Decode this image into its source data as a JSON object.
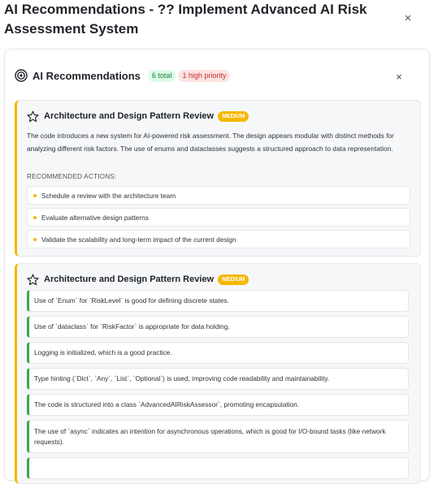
{
  "dialog": {
    "title": "AI Recommendations - ?? Implement Advanced AI Risk Assessment System",
    "close_glyph": "×"
  },
  "panel": {
    "title": "AI Recommendations",
    "total_badge": "6 total",
    "high_badge": "1 high priority",
    "close_glyph": "×"
  },
  "cards": [
    {
      "title": "Architecture and Design Pattern Review",
      "priority": "MEDIUM",
      "description": "The code introduces a new system for AI-powered risk assessment. The design appears modular with distinct methods for analyzing different risk factors. The use of enums and dataclasses suggests a structured approach to data representation.",
      "actions_label": "RECOMMENDED ACTIONS:",
      "actions": [
        "Schedule a review with the architecture team",
        "Evaluate alternative design patterns",
        "Validate the scalability and long-term impact of the current design"
      ]
    },
    {
      "title": "Architecture and Design Pattern Review",
      "priority": "MEDIUM",
      "findings": [
        "Use of `Enum` for `RiskLevel` is good for defining discrete states.",
        "Use of `dataclass` for `RiskFactor` is appropriate for data holding.",
        "Logging is initialized, which is a good practice.",
        "Type hinting (`Dict`, `Any`, `List`, `Optional`) is used, improving code readability and maintainability.",
        "The code is structured into a class `AdvancedAIRiskAssessor`, promoting encapsulation.",
        "The use of `async` indicates an intention for asynchronous operations, which is good for I/O-bound tasks (like network requests)."
      ]
    }
  ],
  "colors": {
    "accent_medium": "#f5b700",
    "finding_border": "#3aa655",
    "badge_total_bg": "#dcfce7",
    "badge_high_bg": "#fde2e2"
  },
  "icons": {
    "panel": "target-icon",
    "card": "star-icon",
    "close": "close-icon"
  }
}
